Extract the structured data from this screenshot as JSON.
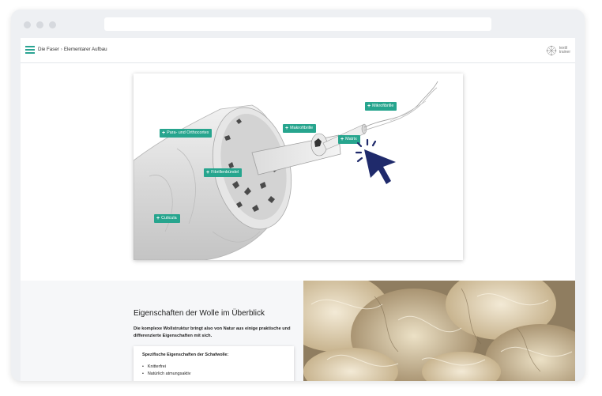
{
  "breadcrumb": {
    "parent": "Die Faser",
    "separator": "›",
    "current": "Elementarer Aufbau"
  },
  "logo": {
    "line1": "textil",
    "line2": "trainer"
  },
  "hotspots": {
    "para_ortho": "Para- und Orthocortex",
    "makrofibrille": "Makrofibrille",
    "mikrofibrille": "Mikrofibrille",
    "matrix": "Matrix",
    "fibrillenbuendel": "Fibrillenbündel",
    "cuticula": "Cuticula"
  },
  "hotspot_icon": "plus-icon",
  "info": {
    "title": "Eigenschaften der Wolle im Überblick",
    "lead": "Die komplexe Wollstruktur bringt also von Natur aus einige praktische und differenzierte Eigenschaften mit sich.",
    "card_title": "Spezifische Eigenschaften der Schafwolle:",
    "items": [
      "Knitterfrei",
      "Natürlich atmungsaktiv"
    ]
  },
  "colors": {
    "accent": "#27a58e",
    "cursor": "#1f2a6b"
  }
}
